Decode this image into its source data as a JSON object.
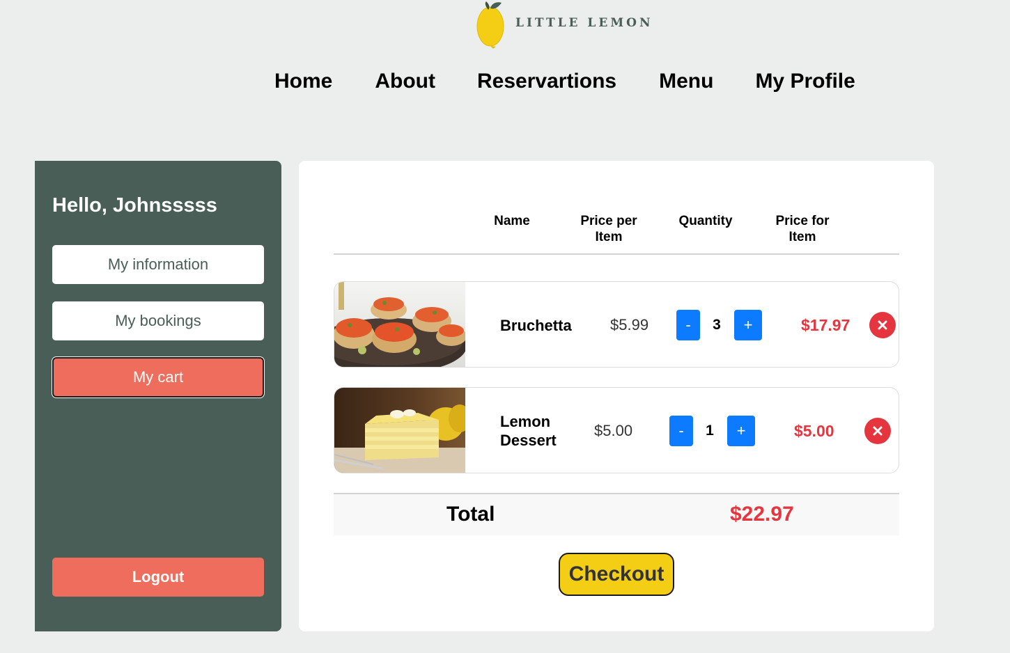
{
  "brand": {
    "name": "LITTLE LEMON",
    "logo_icon": "lemon-icon",
    "accent": "#F4CE14",
    "primary": "#495E57"
  },
  "nav": {
    "items": [
      {
        "label": "Home"
      },
      {
        "label": "About"
      },
      {
        "label": "Reservartions"
      },
      {
        "label": "Menu"
      },
      {
        "label": "My Profile"
      }
    ]
  },
  "sidebar": {
    "greeting": "Hello, Johnsssss",
    "items": [
      {
        "label": "My information",
        "active": false
      },
      {
        "label": "My bookings",
        "active": false
      },
      {
        "label": "My cart",
        "active": true
      }
    ],
    "logout_label": "Logout"
  },
  "cart": {
    "columns": [
      "Name",
      "Price per\nItem",
      "Quantity",
      "Price for\nItem"
    ],
    "items": [
      {
        "name": "Bruchetta",
        "price": "$5.99",
        "quantity": "3",
        "line_total": "$17.97",
        "image": "bruschetta-image"
      },
      {
        "name": "Lemon\nDessert",
        "price": "$5.00",
        "quantity": "1",
        "line_total": "$5.00",
        "image": "lemon-dessert-image"
      }
    ],
    "minus_label": "-",
    "plus_label": "+",
    "total_label": "Total",
    "total_value": "$22.97",
    "checkout_label": "Checkout",
    "total_color": "#E5363F",
    "button_color": "#0D7BFF"
  }
}
